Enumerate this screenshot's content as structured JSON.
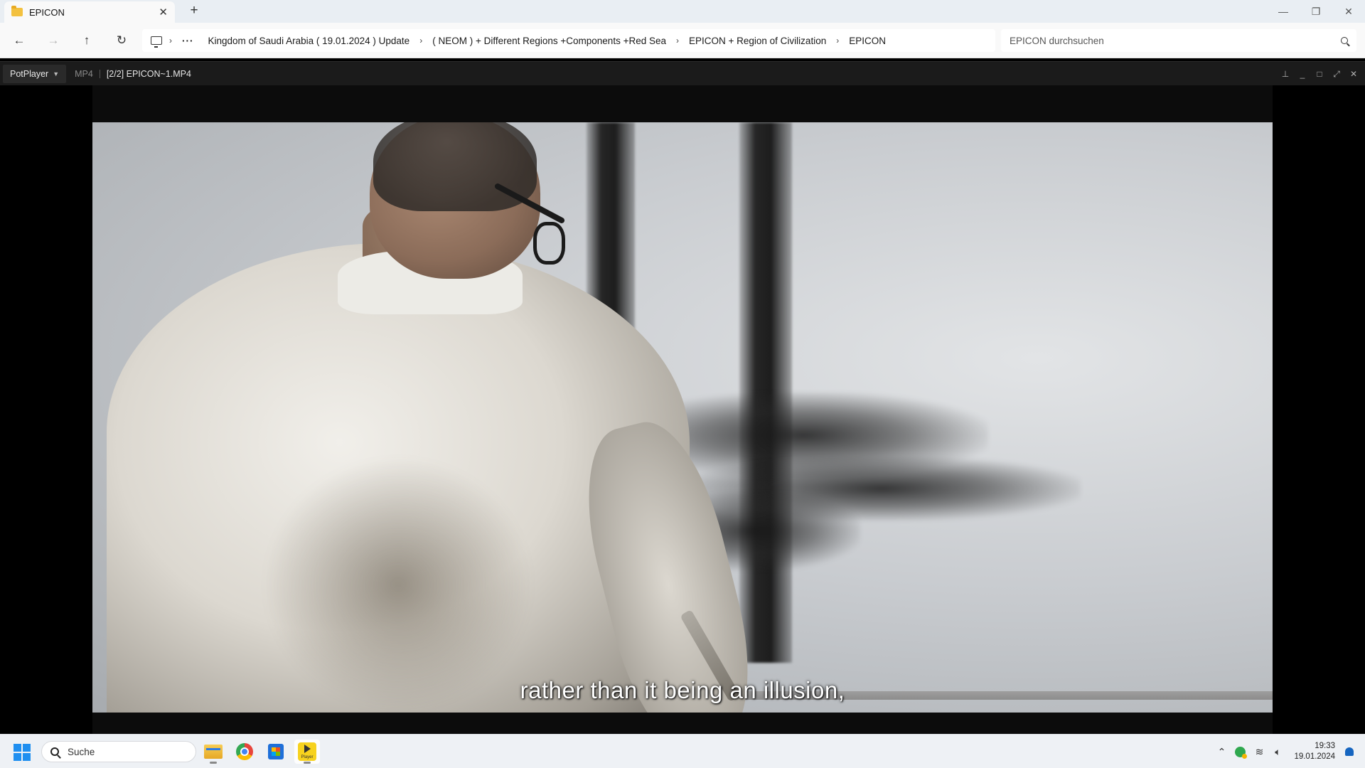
{
  "explorer": {
    "tab_title": "EPICON",
    "tab_close": "✕",
    "new_tab": "+",
    "breadcrumb": [
      "Kingdom of Saudi Arabia ( 19.01.2024 ) Update",
      "( NEOM ) + Different Regions +Components +Red Sea",
      "EPICON + Region of Civilization",
      "EPICON"
    ],
    "overflow": "···",
    "search_placeholder": "EPICON durchsuchen"
  },
  "player": {
    "menu_label": "PotPlayer",
    "format": "MP4",
    "file_title": "[2/2] EPICON~1.MP4",
    "subtitle": "rather than it being an illusion,"
  },
  "taskbar": {
    "search_label": "Suche",
    "pot_icon_text": "Player",
    "time": "19:33",
    "date": "19.01.2024"
  },
  "icons": {
    "back": "back-arrow-icon",
    "forward": "forward-arrow-icon",
    "up": "up-arrow-icon",
    "refresh": "refresh-icon",
    "this_pc": "monitor-icon"
  },
  "colors": {
    "player_bg": "#000000",
    "player_titlebar": "#1b1b1b",
    "taskbar": "#eef1f5",
    "accent": "#1f8ff0"
  }
}
